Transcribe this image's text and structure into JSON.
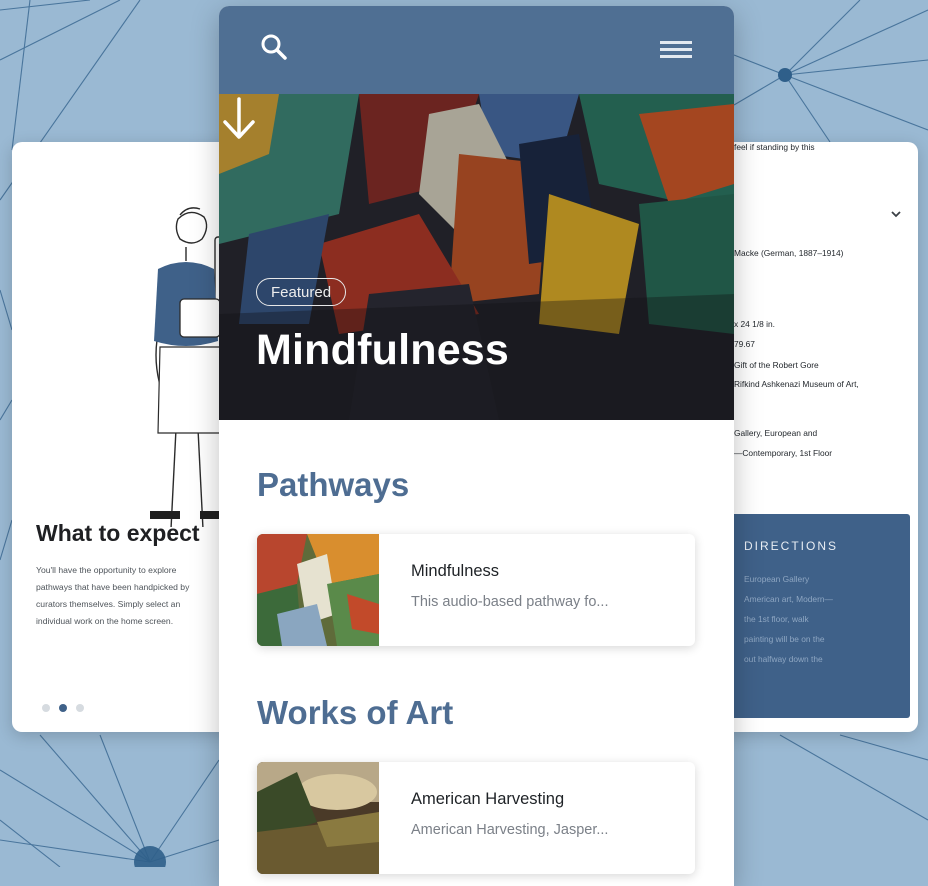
{
  "left_card": {
    "title": "What to expect",
    "body": [
      "You'll have the opportunity to explore",
      "pathways that have been handpicked by",
      "curators themselves. Simply select an",
      "individual work on the home screen."
    ],
    "page_dots": {
      "count": 3,
      "active_index": 1
    }
  },
  "right_card": {
    "lines": [
      "feel if standing by this",
      "Macke (German, 1887–1914)",
      "x 24 1/8 in.",
      "79.67",
      "Gift of the Robert Gore",
      "Rifkind Ashkenazi Museum of Art,",
      "Gallery, European and",
      "—Contemporary, 1st Floor"
    ],
    "directions": {
      "title": "DIRECTIONS",
      "lines": [
        "European Gallery",
        "American art, Modern—",
        "the 1st floor, walk",
        "painting will be on the",
        "out halfway down the"
      ]
    }
  },
  "phone": {
    "featured_badge": "Featured",
    "hero_title": "Mindfulness",
    "sections": {
      "pathways": "Pathways",
      "works_of_art": "Works of Art"
    },
    "pathways": [
      {
        "title": "Mindfulness",
        "subtitle": "This audio-based pathway fo..."
      }
    ],
    "works": [
      {
        "title": "American Harvesting",
        "subtitle": "American Harvesting, Jasper..."
      }
    ]
  },
  "colors": {
    "background": "#9ab9d3",
    "header_blue": "#4f6f93",
    "accent_blue": "#4e6d92",
    "directions_blue": "#3f6189"
  },
  "icons": {
    "search": "search-icon",
    "menu": "menu-icon",
    "arrow_down": "arrow-down-icon",
    "chevron": "chevron-down-icon"
  }
}
